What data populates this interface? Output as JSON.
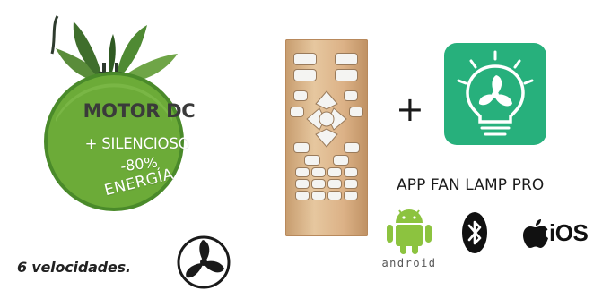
{
  "badge": {
    "title": "MOTOR DC",
    "line2": "+ SILENCIOSO",
    "line3": "-80%",
    "line4": "ENERGÍA"
  },
  "speeds": {
    "label": "6 velocidades."
  },
  "plus": "+",
  "app": {
    "name": "APP FAN LAMP PRO"
  },
  "platforms": {
    "android_label": "android",
    "ios_label": "iOS"
  },
  "icons": {
    "badge_leaf": "leaf-plug-icon",
    "fan_speed": "fan-icon",
    "app": "fan-bulb-app-icon",
    "android": "android-icon",
    "bluetooth": "bluetooth-icon",
    "apple": "apple-icon"
  },
  "colors": {
    "badge_green": "#6cab38",
    "badge_dark_green": "#3f7a22",
    "app_green": "#27b07c",
    "android_green": "#8cc33f"
  }
}
